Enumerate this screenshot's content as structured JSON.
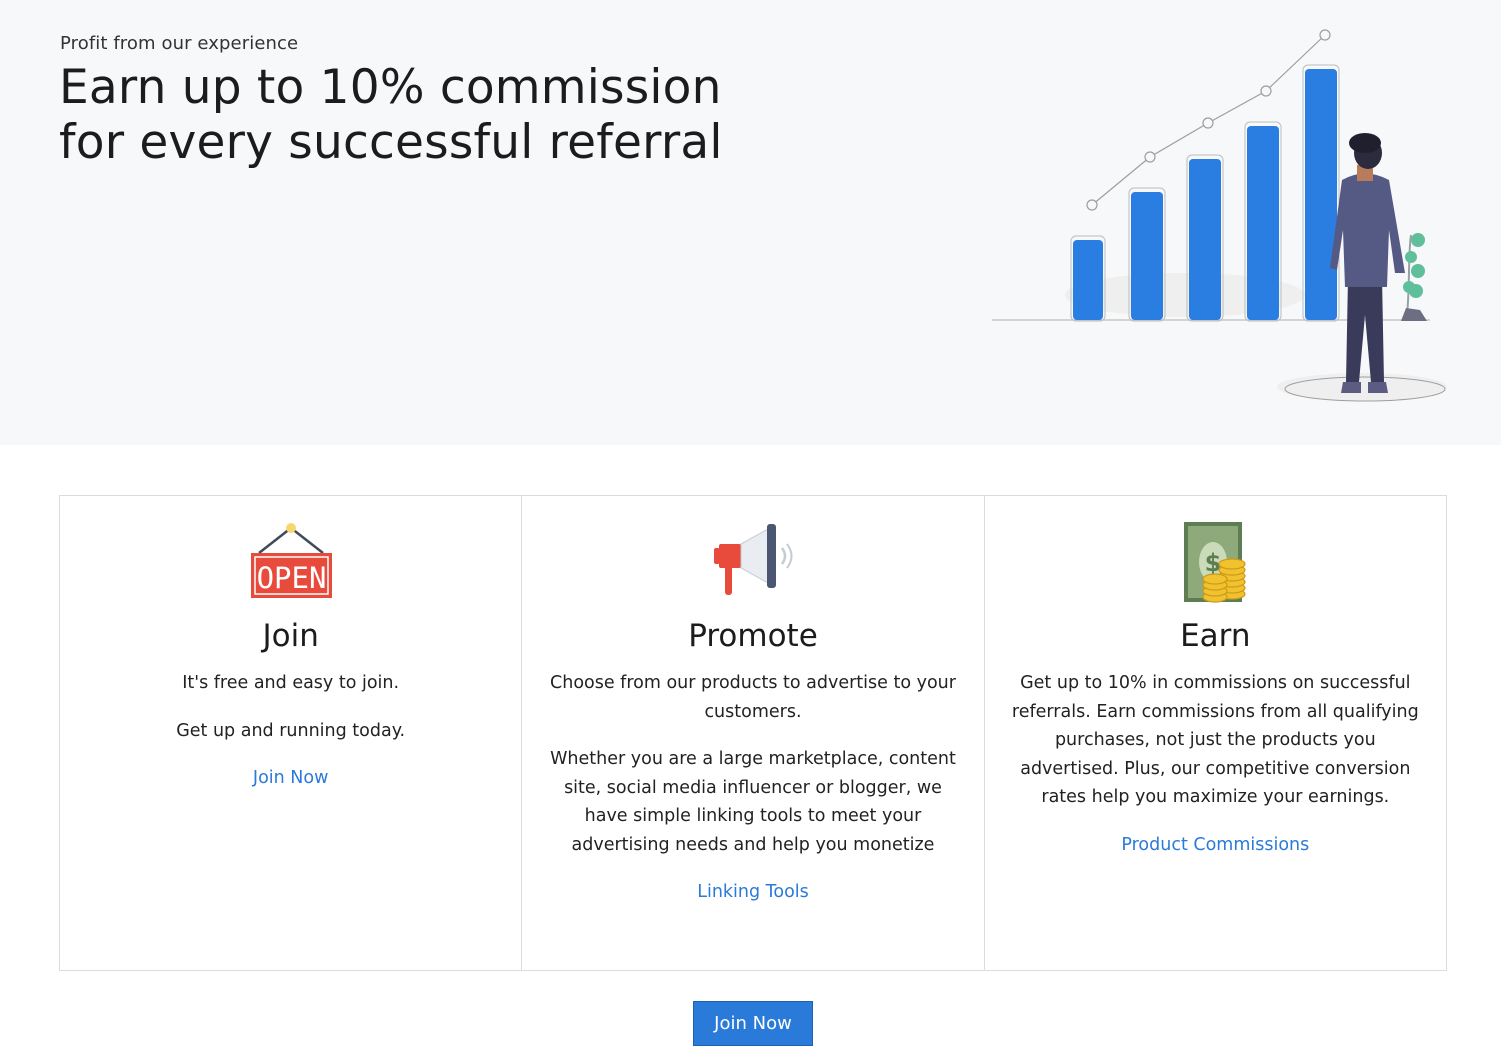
{
  "hero": {
    "kicker": "Profit from our experience",
    "title_line1": "Earn up to 10% commission",
    "title_line2": "for every successful referral"
  },
  "features": [
    {
      "icon": "open-sign-icon",
      "title": "Join",
      "paragraphs": [
        "It's free and easy to join.",
        "Get up and running today."
      ],
      "link": "Join Now",
      "icon_text": "OPEN"
    },
    {
      "icon": "megaphone-icon",
      "title": "Promote",
      "paragraphs": [
        "Choose from our products to advertise to your customers.",
        "Whether you are a large marketplace, content site, social media influencer or blogger, we have simple linking tools to meet your advertising needs and help you monetize"
      ],
      "link": "Linking Tools"
    },
    {
      "icon": "money-coins-icon",
      "title": "Earn",
      "paragraphs": [
        "Get up to 10% in commissions on successful referrals. Earn commissions from all qualifying purchases, not just the products you advertised. Plus, our competitive conversion rates help you maximize your earnings."
      ],
      "link": "Product Commissions"
    }
  ],
  "cta": {
    "label": "Join Now"
  },
  "colors": {
    "accent": "#2a7ad9",
    "hero_bg": "#f7f8fa",
    "bar_blue": "#2a7de1",
    "open_red": "#e84a3c",
    "coin_gold": "#f2c12e",
    "bill_green": "#7e9a6a"
  }
}
